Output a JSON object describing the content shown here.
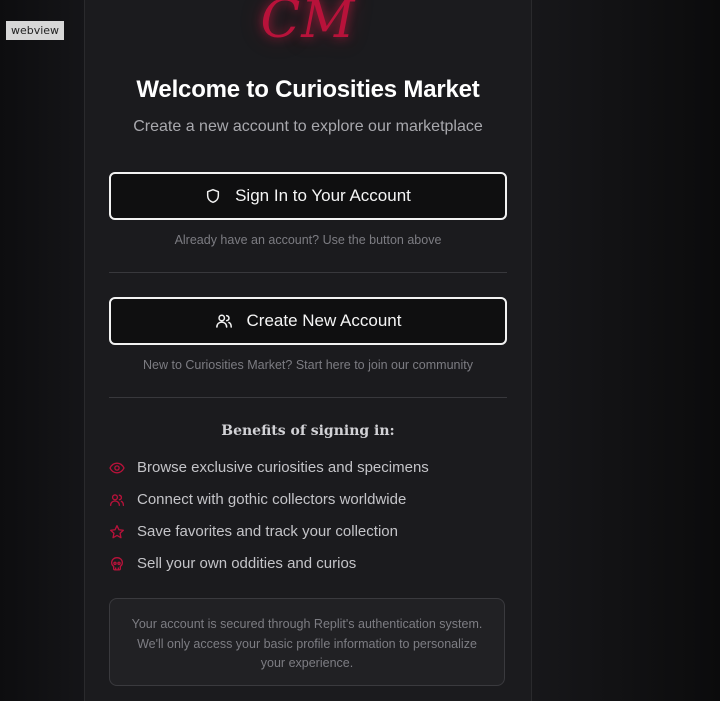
{
  "overlay": {
    "tag_label": "webview"
  },
  "brand": {
    "logo_text": "CM",
    "accent_color": "#b8123a"
  },
  "header": {
    "title": "Welcome to Curiosities Market",
    "subtitle": "Create a new account to explore our marketplace"
  },
  "actions": {
    "signin_label": "Sign In to Your Account",
    "signin_icon": "shield-icon",
    "signin_hint": "Already have an account? Use the button above",
    "create_label": "Create New Account",
    "create_icon": "users-icon",
    "create_hint": "New to Curiosities Market? Start here to join our community"
  },
  "benefits": {
    "title": "Benefits of signing in:",
    "items": [
      {
        "icon": "eye-icon",
        "label": "Browse exclusive curiosities and specimens"
      },
      {
        "icon": "users-icon",
        "label": "Connect with gothic collectors worldwide"
      },
      {
        "icon": "star-icon",
        "label": "Save favorites and track your collection"
      },
      {
        "icon": "skull-icon",
        "label": "Sell your own oddities and curios"
      }
    ]
  },
  "notice": {
    "text": "Your account is secured through Replit's authentication system. We'll only access your basic profile information to personalize your experience."
  }
}
